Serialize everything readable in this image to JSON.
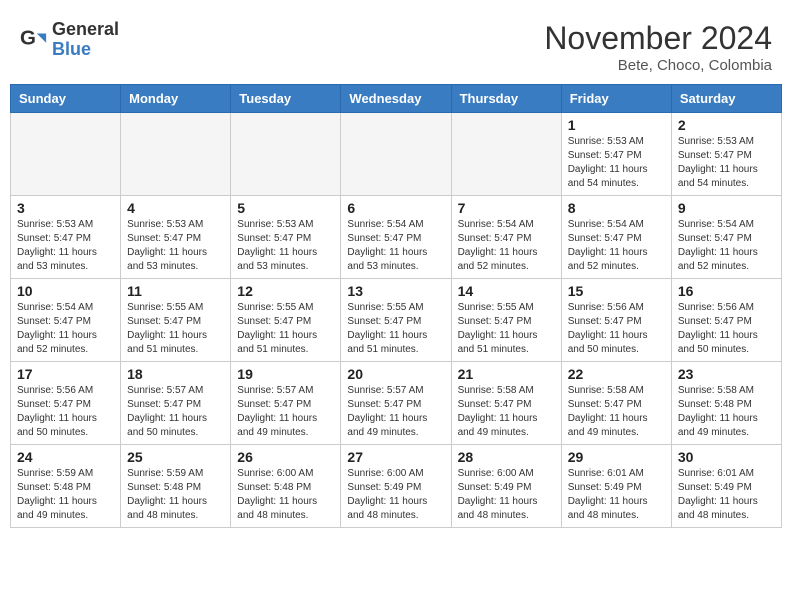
{
  "logo": {
    "general": "General",
    "blue": "Blue"
  },
  "header": {
    "month": "November 2024",
    "location": "Bete, Choco, Colombia"
  },
  "weekdays": [
    "Sunday",
    "Monday",
    "Tuesday",
    "Wednesday",
    "Thursday",
    "Friday",
    "Saturday"
  ],
  "weeks": [
    [
      {
        "day": "",
        "empty": true
      },
      {
        "day": "",
        "empty": true
      },
      {
        "day": "",
        "empty": true
      },
      {
        "day": "",
        "empty": true
      },
      {
        "day": "",
        "empty": true
      },
      {
        "day": "1",
        "sunrise": "5:53 AM",
        "sunset": "5:47 PM",
        "daylight": "11 hours and 54 minutes."
      },
      {
        "day": "2",
        "sunrise": "5:53 AM",
        "sunset": "5:47 PM",
        "daylight": "11 hours and 54 minutes."
      }
    ],
    [
      {
        "day": "3",
        "sunrise": "5:53 AM",
        "sunset": "5:47 PM",
        "daylight": "11 hours and 53 minutes."
      },
      {
        "day": "4",
        "sunrise": "5:53 AM",
        "sunset": "5:47 PM",
        "daylight": "11 hours and 53 minutes."
      },
      {
        "day": "5",
        "sunrise": "5:53 AM",
        "sunset": "5:47 PM",
        "daylight": "11 hours and 53 minutes."
      },
      {
        "day": "6",
        "sunrise": "5:54 AM",
        "sunset": "5:47 PM",
        "daylight": "11 hours and 53 minutes."
      },
      {
        "day": "7",
        "sunrise": "5:54 AM",
        "sunset": "5:47 PM",
        "daylight": "11 hours and 52 minutes."
      },
      {
        "day": "8",
        "sunrise": "5:54 AM",
        "sunset": "5:47 PM",
        "daylight": "11 hours and 52 minutes."
      },
      {
        "day": "9",
        "sunrise": "5:54 AM",
        "sunset": "5:47 PM",
        "daylight": "11 hours and 52 minutes."
      }
    ],
    [
      {
        "day": "10",
        "sunrise": "5:54 AM",
        "sunset": "5:47 PM",
        "daylight": "11 hours and 52 minutes."
      },
      {
        "day": "11",
        "sunrise": "5:55 AM",
        "sunset": "5:47 PM",
        "daylight": "11 hours and 51 minutes."
      },
      {
        "day": "12",
        "sunrise": "5:55 AM",
        "sunset": "5:47 PM",
        "daylight": "11 hours and 51 minutes."
      },
      {
        "day": "13",
        "sunrise": "5:55 AM",
        "sunset": "5:47 PM",
        "daylight": "11 hours and 51 minutes."
      },
      {
        "day": "14",
        "sunrise": "5:55 AM",
        "sunset": "5:47 PM",
        "daylight": "11 hours and 51 minutes."
      },
      {
        "day": "15",
        "sunrise": "5:56 AM",
        "sunset": "5:47 PM",
        "daylight": "11 hours and 50 minutes."
      },
      {
        "day": "16",
        "sunrise": "5:56 AM",
        "sunset": "5:47 PM",
        "daylight": "11 hours and 50 minutes."
      }
    ],
    [
      {
        "day": "17",
        "sunrise": "5:56 AM",
        "sunset": "5:47 PM",
        "daylight": "11 hours and 50 minutes."
      },
      {
        "day": "18",
        "sunrise": "5:57 AM",
        "sunset": "5:47 PM",
        "daylight": "11 hours and 50 minutes."
      },
      {
        "day": "19",
        "sunrise": "5:57 AM",
        "sunset": "5:47 PM",
        "daylight": "11 hours and 49 minutes."
      },
      {
        "day": "20",
        "sunrise": "5:57 AM",
        "sunset": "5:47 PM",
        "daylight": "11 hours and 49 minutes."
      },
      {
        "day": "21",
        "sunrise": "5:58 AM",
        "sunset": "5:47 PM",
        "daylight": "11 hours and 49 minutes."
      },
      {
        "day": "22",
        "sunrise": "5:58 AM",
        "sunset": "5:47 PM",
        "daylight": "11 hours and 49 minutes."
      },
      {
        "day": "23",
        "sunrise": "5:58 AM",
        "sunset": "5:48 PM",
        "daylight": "11 hours and 49 minutes."
      }
    ],
    [
      {
        "day": "24",
        "sunrise": "5:59 AM",
        "sunset": "5:48 PM",
        "daylight": "11 hours and 49 minutes."
      },
      {
        "day": "25",
        "sunrise": "5:59 AM",
        "sunset": "5:48 PM",
        "daylight": "11 hours and 48 minutes."
      },
      {
        "day": "26",
        "sunrise": "6:00 AM",
        "sunset": "5:48 PM",
        "daylight": "11 hours and 48 minutes."
      },
      {
        "day": "27",
        "sunrise": "6:00 AM",
        "sunset": "5:49 PM",
        "daylight": "11 hours and 48 minutes."
      },
      {
        "day": "28",
        "sunrise": "6:00 AM",
        "sunset": "5:49 PM",
        "daylight": "11 hours and 48 minutes."
      },
      {
        "day": "29",
        "sunrise": "6:01 AM",
        "sunset": "5:49 PM",
        "daylight": "11 hours and 48 minutes."
      },
      {
        "day": "30",
        "sunrise": "6:01 AM",
        "sunset": "5:49 PM",
        "daylight": "11 hours and 48 minutes."
      }
    ]
  ]
}
